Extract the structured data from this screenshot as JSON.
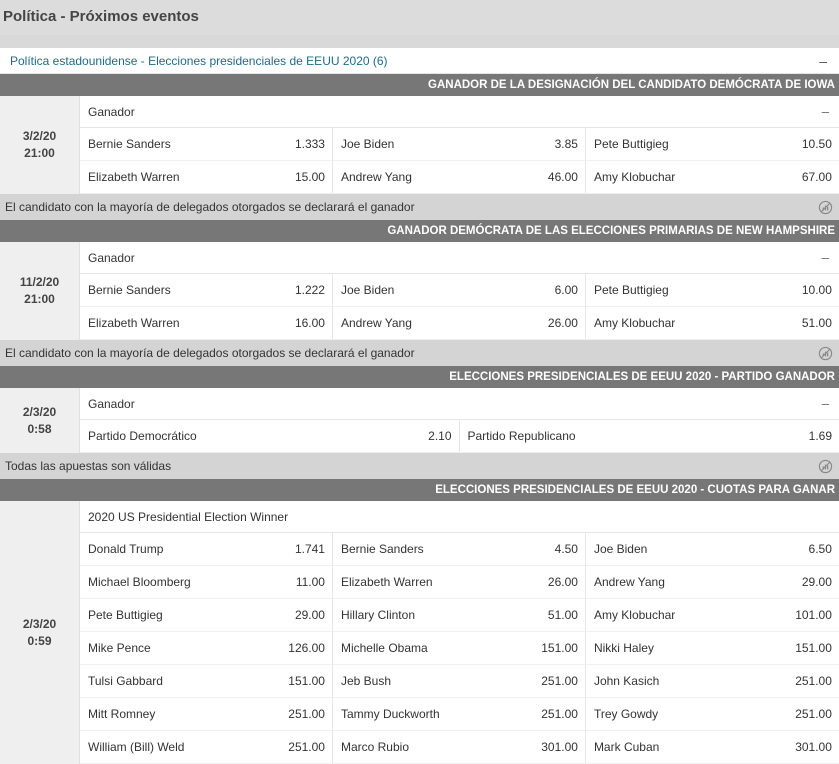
{
  "page_title": "Política - Próximos eventos",
  "competition": {
    "title": "Política estadounidense - Elecciones presidenciales de EEUU 2020 (6)",
    "toggle": "–"
  },
  "events": [
    {
      "header": "Ganador de la designación del candidato Demócrata de Iowa",
      "date": "3/2/20",
      "time": "21:00",
      "market_title": "Ganador",
      "market_toggle": "–",
      "rows": [
        [
          {
            "name": "Bernie Sanders",
            "odds": "1.333"
          },
          {
            "name": "Joe Biden",
            "odds": "3.85"
          },
          {
            "name": "Pete Buttigieg",
            "odds": "10.50"
          }
        ],
        [
          {
            "name": "Elizabeth Warren",
            "odds": "15.00"
          },
          {
            "name": "Andrew Yang",
            "odds": "46.00"
          },
          {
            "name": "Amy Klobuchar",
            "odds": "67.00"
          }
        ]
      ],
      "info": "El candidato con la mayoría de delegados otorgados se declarará el ganador"
    },
    {
      "header": "Ganador Demócrata de las elecciones primarias de New Hampshire",
      "date": "11/2/20",
      "time": "21:00",
      "market_title": "Ganador",
      "market_toggle": "–",
      "rows": [
        [
          {
            "name": "Bernie Sanders",
            "odds": "1.222"
          },
          {
            "name": "Joe Biden",
            "odds": "6.00"
          },
          {
            "name": "Pete Buttigieg",
            "odds": "10.00"
          }
        ],
        [
          {
            "name": "Elizabeth Warren",
            "odds": "16.00"
          },
          {
            "name": "Andrew Yang",
            "odds": "26.00"
          },
          {
            "name": "Amy Klobuchar",
            "odds": "51.00"
          }
        ]
      ],
      "info": "El candidato con la mayoría de delegados otorgados se declarará el ganador"
    },
    {
      "header": "Elecciones presidenciales de EEUU 2020 - Partido Ganador",
      "date": "2/3/20",
      "time": "0:58",
      "market_title": "Ganador",
      "market_toggle": "–",
      "rows": [
        [
          {
            "name": "Partido Democrático",
            "odds": "2.10"
          },
          {
            "name": "Partido Republicano",
            "odds": "1.69"
          }
        ]
      ],
      "info": "Todas las apuestas son válidas"
    },
    {
      "header": "Elecciones presidenciales de EEUU 2020 - Cuotas para ganar",
      "date": "2/3/20",
      "time": "0:59",
      "market_title": "2020 US Presidential Election Winner",
      "market_toggle": "",
      "rows": [
        [
          {
            "name": "Donald Trump",
            "odds": "1.741"
          },
          {
            "name": "Bernie Sanders",
            "odds": "4.50"
          },
          {
            "name": "Joe Biden",
            "odds": "6.50"
          }
        ],
        [
          {
            "name": "Michael Bloomberg",
            "odds": "11.00"
          },
          {
            "name": "Elizabeth Warren",
            "odds": "26.00"
          },
          {
            "name": "Andrew Yang",
            "odds": "29.00"
          }
        ],
        [
          {
            "name": "Pete Buttigieg",
            "odds": "29.00"
          },
          {
            "name": "Hillary Clinton",
            "odds": "51.00"
          },
          {
            "name": "Amy Klobuchar",
            "odds": "101.00"
          }
        ],
        [
          {
            "name": "Mike Pence",
            "odds": "126.00"
          },
          {
            "name": "Michelle Obama",
            "odds": "151.00"
          },
          {
            "name": "Nikki Haley",
            "odds": "151.00"
          }
        ],
        [
          {
            "name": "Tulsi Gabbard",
            "odds": "151.00"
          },
          {
            "name": "Jeb Bush",
            "odds": "251.00"
          },
          {
            "name": "John Kasich",
            "odds": "251.00"
          }
        ],
        [
          {
            "name": "Mitt Romney",
            "odds": "251.00"
          },
          {
            "name": "Tammy Duckworth",
            "odds": "251.00"
          },
          {
            "name": "Trey Gowdy",
            "odds": "251.00"
          }
        ],
        [
          {
            "name": "William (Bill) Weld",
            "odds": "251.00"
          },
          {
            "name": "Marco Rubio",
            "odds": "301.00"
          },
          {
            "name": "Mark Cuban",
            "odds": "301.00"
          }
        ]
      ],
      "info": ""
    }
  ],
  "icons": {
    "info_bar_icon": "no-statistics-icon",
    "toggle_icon": "collapse-dash-icon"
  },
  "colors": {
    "header_bg": "#777777",
    "info_bar_bg": "#d4d4d4",
    "link_blue": "#1f6a8a"
  }
}
